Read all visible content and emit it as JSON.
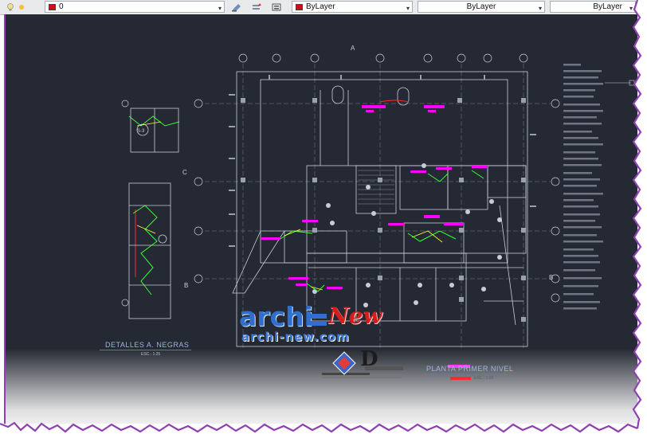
{
  "toolbar": {
    "layer_value": "0",
    "color_value": "ByLayer",
    "linetype_value": "ByLayer",
    "lineweight_value": "ByLayer",
    "colors": {
      "layer_swatch": "#cc1111",
      "color_swatch": "#cc1111"
    }
  },
  "drawing": {
    "grid_marker_a": "A",
    "grid_marker_b": "B",
    "grid_marker_c": "C",
    "detail_marker_s3": "S-3",
    "detail_label": "DETALLES A. NEGRAS",
    "detail_scale": "ESC.: 1:25",
    "plan_label": "PLANTA PRIMER NIVEL",
    "plan_scale": "ESC.: 1:50"
  },
  "watermark": {
    "archi": "archi",
    "new": "New",
    "url": "archi-new.com",
    "logo_letter": "D"
  },
  "colors": {
    "canvas": "#252933",
    "lines": "#c8ccd6",
    "magenta": "#ff00ff",
    "green": "#33ff33",
    "yellow": "#ffff33",
    "red": "#ff2a2a",
    "label_underline": "#3f7ed6",
    "watermark_blue": "#2f6fd0",
    "frame_purple": "#8e3fb0"
  }
}
